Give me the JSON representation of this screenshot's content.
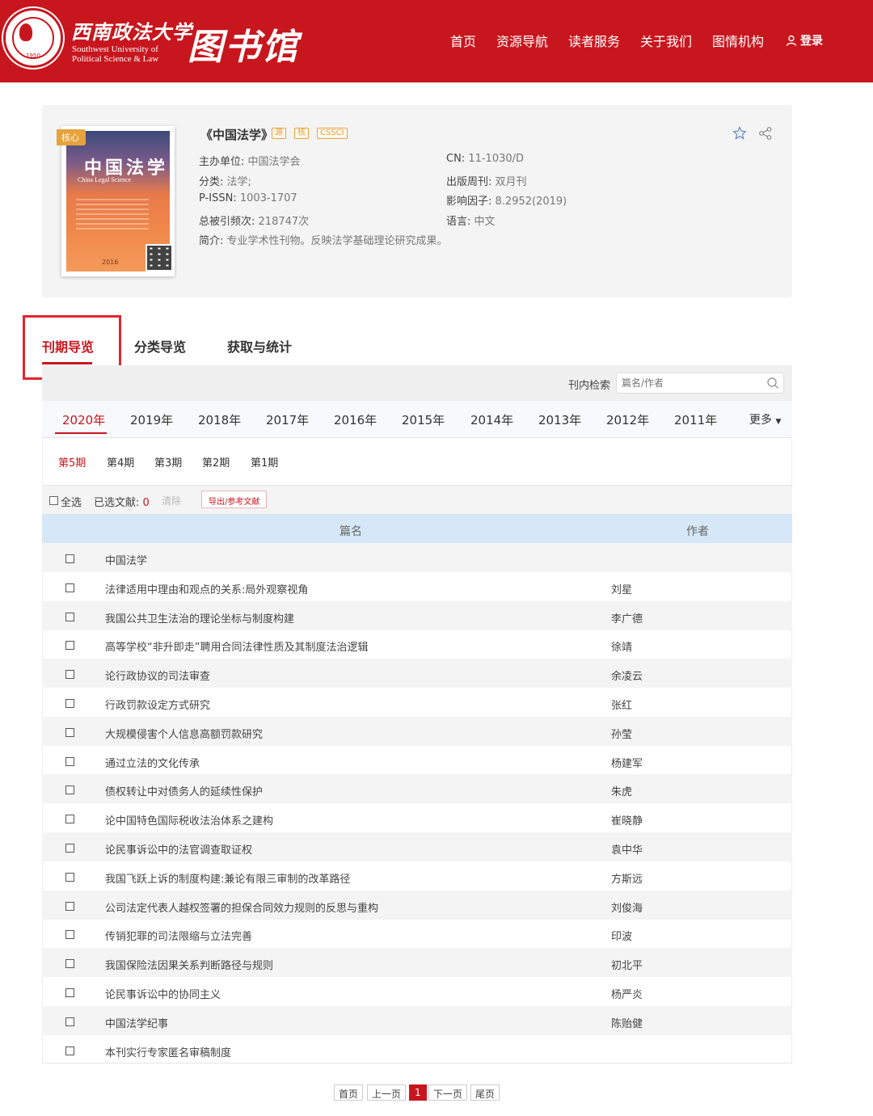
{
  "header": {
    "university_cn": "西南政法大学",
    "university_en_line1": "Southwest University of",
    "university_en_line2": "Political Science & Law",
    "library_title": "图书馆",
    "seal_year": "1950",
    "nav": [
      "首页",
      "资源导航",
      "读者服务",
      "关于我们",
      "图情机构"
    ],
    "login_label": "登录",
    "brand_color": "#c8161e"
  },
  "journal": {
    "title": "《中国法学》",
    "tags": [
      "源",
      "核",
      "CSSCI"
    ],
    "cover_tag": "核心",
    "cover_title": "中国法学",
    "cover_subtitle": "China Legal Science",
    "cover_year": "2016",
    "left_fields": [
      {
        "k": "主办单位:",
        "v": "中国法学会"
      },
      {
        "k": "分类:",
        "v": "法学;"
      },
      {
        "k": "P-ISSN:",
        "v": "1003-1707"
      },
      {
        "k": "总被引频次:",
        "v": "218747次"
      }
    ],
    "right_fields": [
      {
        "k": "CN:",
        "v": "11-1030/D"
      },
      {
        "k": "出版周刊:",
        "v": "双月刊"
      },
      {
        "k": "影响因子:",
        "v": "8.2952(2019)"
      },
      {
        "k": "语言:",
        "v": "中文"
      }
    ],
    "summary_key": "简介:",
    "summary_value": "专业学术性刊物。反映法学基础理论研究成果。",
    "icons": [
      "star-icon",
      "share-icon"
    ]
  },
  "tabs": [
    "刊期导览",
    "分类导览",
    "获取与统计"
  ],
  "search": {
    "label": "刊内检索",
    "placeholder": "篇名/作者"
  },
  "years": [
    "2020年",
    "2019年",
    "2018年",
    "2017年",
    "2016年",
    "2015年",
    "2014年",
    "2013年",
    "2012年",
    "2011年"
  ],
  "more_label": "更多",
  "issues": [
    "第5期",
    "第4期",
    "第3期",
    "第2期",
    "第1期"
  ],
  "selection": {
    "select_all": "全选",
    "selected_label": "已选文献:",
    "selected_count": "0",
    "clear": "清除",
    "export": "导出/参考文献"
  },
  "table": {
    "headers": [
      "篇名",
      "作者"
    ],
    "rows": [
      {
        "title": "中国法学",
        "author": ""
      },
      {
        "title": "法律适用中理由和观点的关系:局外观察视角",
        "author": "刘星"
      },
      {
        "title": "我国公共卫生法治的理论坐标与制度构建",
        "author": "李广德"
      },
      {
        "title": "高等学校“非升即走”聘用合同法律性质及其制度法治逻辑",
        "author": "徐靖"
      },
      {
        "title": "论行政协议的司法审查",
        "author": "余凌云"
      },
      {
        "title": "行政罚款设定方式研究",
        "author": "张红"
      },
      {
        "title": "大规模侵害个人信息高额罚款研究",
        "author": "孙莹"
      },
      {
        "title": "通过立法的文化传承",
        "author": "杨建军"
      },
      {
        "title": "债权转让中对债务人的延续性保护",
        "author": "朱虎"
      },
      {
        "title": "论中国特色国际税收法治体系之建构",
        "author": "崔晓静"
      },
      {
        "title": "论民事诉讼中的法官调查取证权",
        "author": "袁中华"
      },
      {
        "title": "我国飞跃上诉的制度构建:兼论有限三审制的改革路径",
        "author": "方斯远"
      },
      {
        "title": "公司法定代表人越权签署的担保合同效力规则的反思与重构",
        "author": "刘俊海"
      },
      {
        "title": "传销犯罪的司法限缩与立法完善",
        "author": "印波"
      },
      {
        "title": "我国保险法因果关系判断路径与规则",
        "author": "初北平"
      },
      {
        "title": "论民事诉讼中的协同主义",
        "author": "杨严炎"
      },
      {
        "title": "中国法学纪事",
        "author": "陈贻健"
      },
      {
        "title": "本刊实行专家匿名审稿制度",
        "author": ""
      }
    ]
  },
  "pagination": {
    "first": "首页",
    "prev": "上一页",
    "current": "1",
    "next": "下一页",
    "last": "尾页"
  }
}
